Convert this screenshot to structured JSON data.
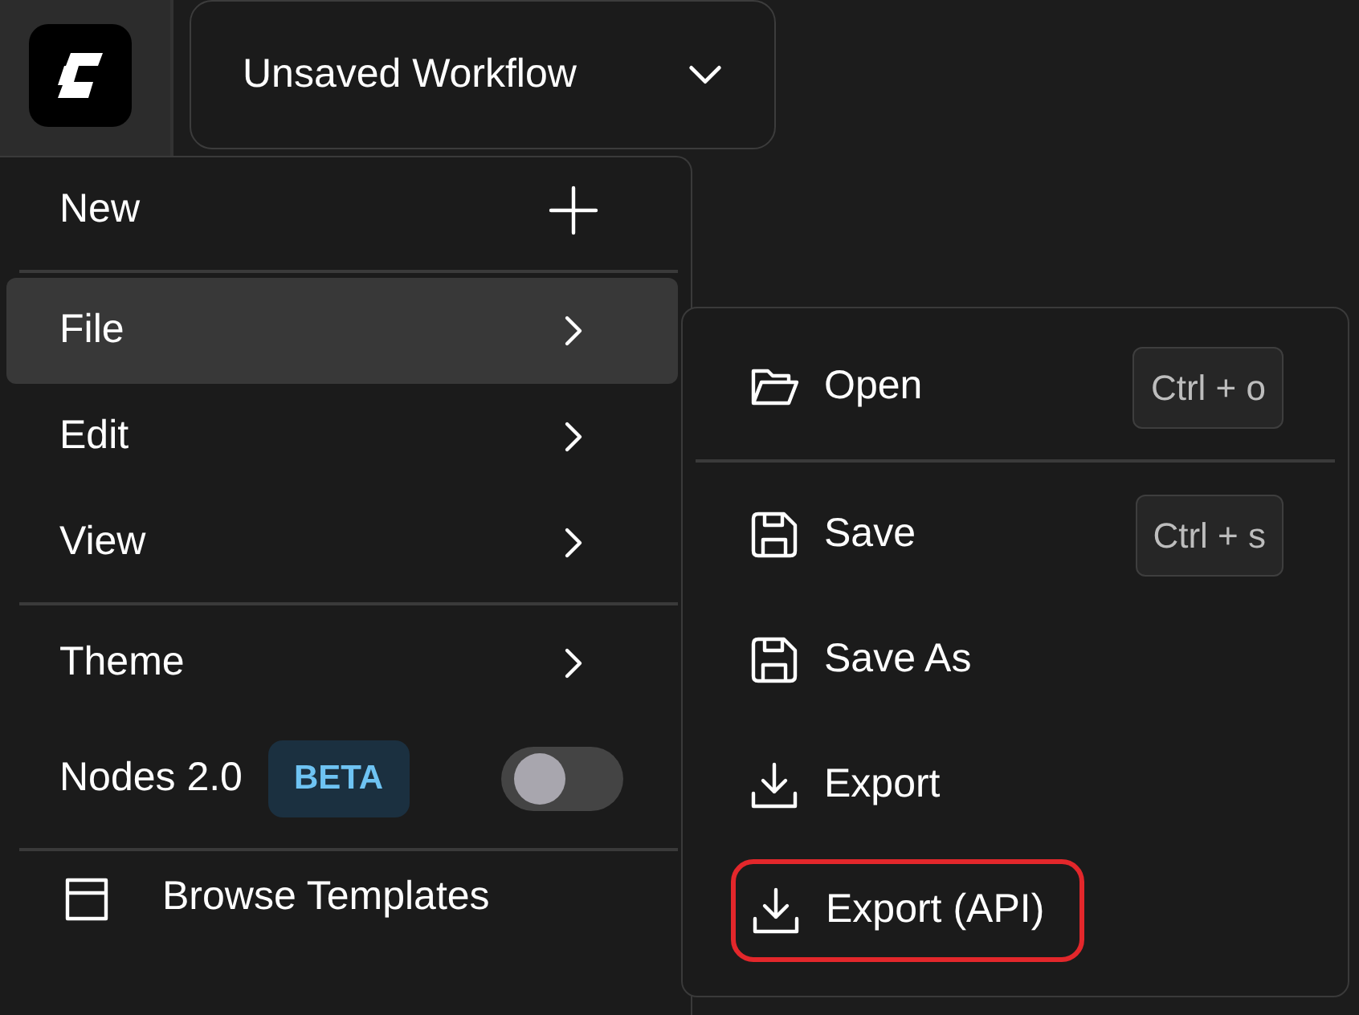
{
  "workflow_button": {
    "label": "Unsaved Workflow"
  },
  "menu": [
    {
      "kind": "new",
      "label": "New",
      "selected": false
    },
    {
      "kind": "divider"
    },
    {
      "kind": "submenu",
      "label": "File",
      "selected": true
    },
    {
      "kind": "submenu",
      "label": "Edit",
      "selected": false
    },
    {
      "kind": "submenu",
      "label": "View",
      "selected": false
    },
    {
      "kind": "divider"
    },
    {
      "kind": "submenu",
      "label": "Theme",
      "selected": false
    },
    {
      "kind": "toggle",
      "label": "Nodes 2.0",
      "badge": "BETA",
      "on": false
    },
    {
      "kind": "divider"
    },
    {
      "kind": "templates",
      "label": "Browse Templates",
      "selected": false
    }
  ],
  "submenu": [
    {
      "kind": "open",
      "label": "Open",
      "shortcut": "Ctrl + o",
      "highlighted": false
    },
    {
      "kind": "divider"
    },
    {
      "kind": "save",
      "label": "Save",
      "shortcut": "Ctrl + s",
      "highlighted": false
    },
    {
      "kind": "save",
      "label": "Save As",
      "highlighted": false
    },
    {
      "kind": "export",
      "label": "Export",
      "highlighted": false
    },
    {
      "kind": "export",
      "label": "Export (API)",
      "highlighted": true
    }
  ]
}
